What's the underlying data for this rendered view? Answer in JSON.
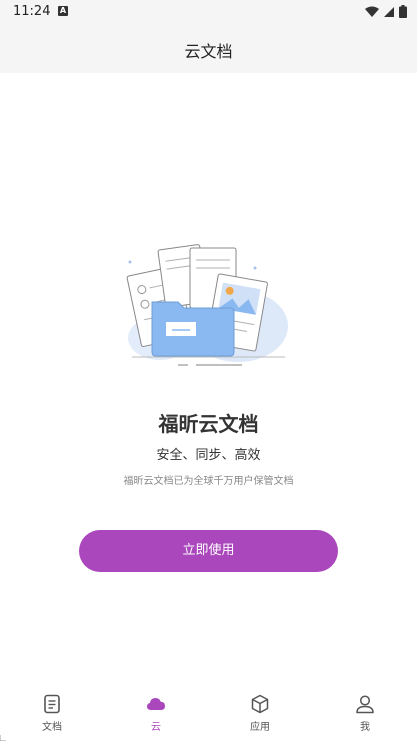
{
  "status_bar": {
    "time": "11:24",
    "a_badge": "A"
  },
  "header": {
    "title": "云文档"
  },
  "hero": {
    "title": "福昕云文档",
    "subtitle": "安全、同步、高效",
    "description": "福昕云文档已为全球千万用户保管文档",
    "button_label": "立即使用"
  },
  "bottom_nav": {
    "items": [
      {
        "label": "文档",
        "icon": "document-icon",
        "active": false
      },
      {
        "label": "云",
        "icon": "cloud-icon",
        "active": true
      },
      {
        "label": "应用",
        "icon": "cube-icon",
        "active": false
      },
      {
        "label": "我",
        "icon": "person-icon",
        "active": false
      }
    ]
  },
  "colors": {
    "accent": "#ab47bc",
    "header_bg": "#f5f5f5",
    "folder_blue": "#8ab8f0"
  }
}
